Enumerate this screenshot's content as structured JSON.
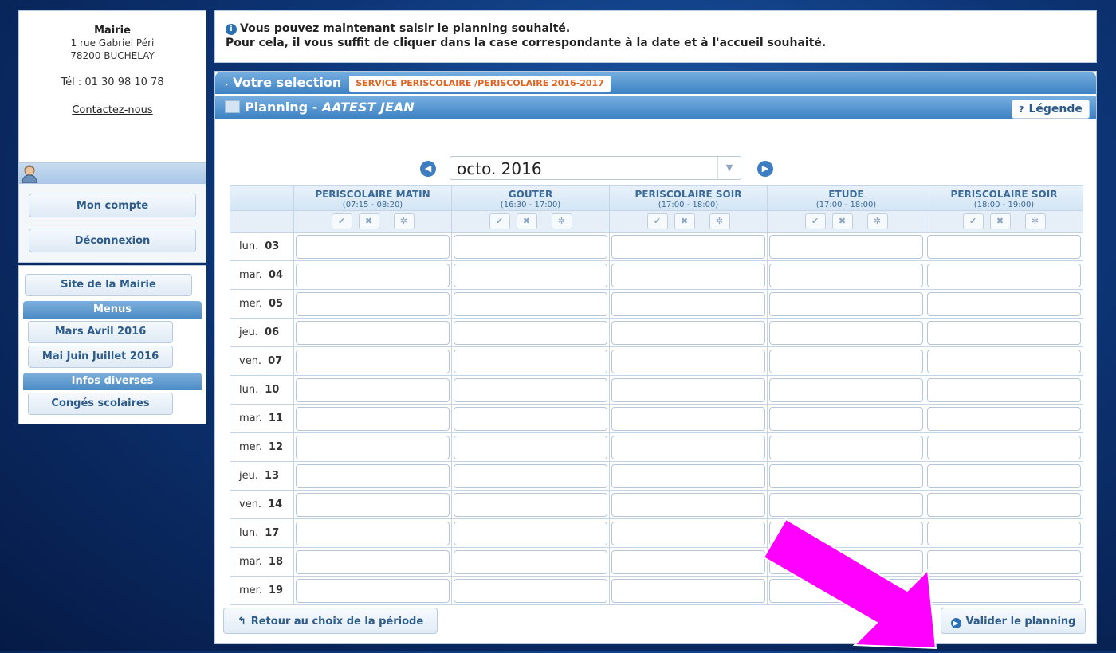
{
  "sidebar": {
    "mairie_title": "Mairie",
    "address_line1": "1 rue Gabriel Péri",
    "address_line2": "78200 BUCHELAY",
    "tel": "Tél : 01 30 98 10 78",
    "contact_link": "Contactez-nous",
    "account_button": "Mon compte",
    "logout_button": "Déconnexion",
    "site_button": "Site de la Mairie",
    "menus_header": "Menus",
    "menus_items": [
      "Mars Avril 2016",
      "Mai Juin Juillet 2016"
    ],
    "infos_header": "Infos diverses",
    "infos_items": [
      "Congés scolaires"
    ]
  },
  "info": {
    "line1": "Vous pouvez maintenant saisir le planning souhaité.",
    "line2": "Pour cela, il vous suffit de cliquer dans la case correspondante à la date et à l'accueil souhaité."
  },
  "selection": {
    "label": "Votre selection",
    "badge": "SERVICE PERISCOLAIRE /PERISCOLAIRE 2016-2017"
  },
  "planning": {
    "title": "Planning - ",
    "name": "AATEST JEAN",
    "legend_button": "Légende",
    "month": "octo. 2016"
  },
  "columns": [
    {
      "name": "PERISCOLAIRE MATIN",
      "hours": "(07:15 - 08:20)"
    },
    {
      "name": "GOUTER",
      "hours": "(16:30 - 17:00)"
    },
    {
      "name": "PERISCOLAIRE SOIR",
      "hours": "(17:00 - 18:00)"
    },
    {
      "name": "ETUDE",
      "hours": "(17:00 - 18:00)"
    },
    {
      "name": "PERISCOLAIRE SOIR",
      "hours": "(18:00 - 19:00)"
    }
  ],
  "days": [
    {
      "label": "lun.",
      "num": "03"
    },
    {
      "label": "mar.",
      "num": "04"
    },
    {
      "label": "mer.",
      "num": "05"
    },
    {
      "label": "jeu.",
      "num": "06"
    },
    {
      "label": "ven.",
      "num": "07"
    },
    {
      "label": "lun.",
      "num": "10"
    },
    {
      "label": "mar.",
      "num": "11"
    },
    {
      "label": "mer.",
      "num": "12"
    },
    {
      "label": "jeu.",
      "num": "13"
    },
    {
      "label": "ven.",
      "num": "14"
    },
    {
      "label": "lun.",
      "num": "17"
    },
    {
      "label": "mar.",
      "num": "18"
    },
    {
      "label": "mer.",
      "num": "19"
    }
  ],
  "buttons": {
    "back": "Retour au choix de la période",
    "validate": "Valider le planning"
  },
  "colors": {
    "accent": "#3d82c4",
    "badge_text": "#e0621c",
    "arrow": "#ff00ff"
  }
}
